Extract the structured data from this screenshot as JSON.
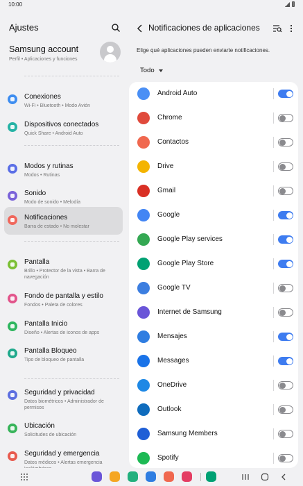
{
  "status": {
    "time": "10:00"
  },
  "left": {
    "title": "Ajustes",
    "account": {
      "name": "Samsung account",
      "sub": "Perfil  •  Aplicaciones y funciones"
    },
    "items": [
      {
        "title": "Conexiones",
        "sub": "Wi-Fi  •  Bluetooth  •  Modo Avión",
        "color": "#3e8df0"
      },
      {
        "title": "Dispositivos conectados",
        "sub": "Quick Share  •  Android Auto",
        "color": "#26b3a5"
      },
      {
        "title": "Modos y rutinas",
        "sub": "Modos  •  Rutinas",
        "color": "#5a6ee6"
      },
      {
        "title": "Sonido",
        "sub": "Modo de sonido  •  Melodía",
        "color": "#7a62d9"
      },
      {
        "title": "Notificaciones",
        "sub": "Barra de estado  •  No molestar",
        "color": "#f0675c"
      },
      {
        "title": "Pantalla",
        "sub": "Brillo  •  Protector de la vista  •  Barra de navegación",
        "color": "#7cc035"
      },
      {
        "title": "Fondo de pantalla y estilo",
        "sub": "Fondos  •  Paleta de colores",
        "color": "#e2558b"
      },
      {
        "title": "Pantalla Inicio",
        "sub": "Diseño  •  Alertas de iconos de apps",
        "color": "#2fb65f"
      },
      {
        "title": "Pantalla Bloqueo",
        "sub": "Tipo de bloqueo de pantalla",
        "color": "#20a98c"
      },
      {
        "title": "Seguridad y privacidad",
        "sub": "Datos biométricos  •  Administrador de permisos",
        "color": "#5d6fe0"
      },
      {
        "title": "Ubicación",
        "sub": "Solicitudes de ubicación",
        "color": "#38b45a"
      },
      {
        "title": "Seguridad y emergencia",
        "sub": "Datos médicos  •  Alertas emergencia inalámbricas",
        "color": "#e85b4f"
      }
    ]
  },
  "right": {
    "title": "Notificaciones de aplicaciones",
    "description": "Elige qué aplicaciones pueden enviarte notificaciones.",
    "filter": "Todo",
    "apps": [
      {
        "name": "Android Auto",
        "enabled": true,
        "icon": "android-auto-icon",
        "color": "#4a8ff5"
      },
      {
        "name": "Chrome",
        "enabled": false,
        "icon": "chrome-icon",
        "color": "#e04a3c"
      },
      {
        "name": "Contactos",
        "enabled": false,
        "icon": "contacts-icon",
        "color": "#f0684f"
      },
      {
        "name": "Drive",
        "enabled": false,
        "icon": "drive-icon",
        "color": "#f4b400"
      },
      {
        "name": "Gmail",
        "enabled": false,
        "icon": "gmail-icon",
        "color": "#d93025"
      },
      {
        "name": "Google",
        "enabled": true,
        "icon": "google-icon",
        "color": "#4285f4"
      },
      {
        "name": "Google Play services",
        "enabled": true,
        "icon": "play-services-icon",
        "color": "#34a853"
      },
      {
        "name": "Google Play Store",
        "enabled": true,
        "icon": "play-store-icon",
        "color": "#00a173"
      },
      {
        "name": "Google TV",
        "enabled": false,
        "icon": "google-tv-icon",
        "color": "#3c7ee0"
      },
      {
        "name": "Internet de Samsung",
        "enabled": false,
        "icon": "samsung-internet-icon",
        "color": "#6a55d8"
      },
      {
        "name": "Mensajes",
        "enabled": true,
        "icon": "messages-icon",
        "color": "#2f7de1"
      },
      {
        "name": "Messages",
        "enabled": true,
        "icon": "google-messages-icon",
        "color": "#1a73e8"
      },
      {
        "name": "OneDrive",
        "enabled": false,
        "icon": "onedrive-icon",
        "color": "#1e88e5"
      },
      {
        "name": "Outlook",
        "enabled": false,
        "icon": "outlook-icon",
        "color": "#0f6cbd"
      },
      {
        "name": "Samsung Members",
        "enabled": false,
        "icon": "samsung-members-icon",
        "color": "#1f5fd6"
      },
      {
        "name": "Spotify",
        "enabled": false,
        "icon": "spotify-icon",
        "color": "#1db954"
      }
    ]
  },
  "dock": [
    {
      "name": "internet-dock-icon",
      "color": "#6a55d8"
    },
    {
      "name": "files-dock-icon",
      "color": "#f5a623"
    },
    {
      "name": "phone-dock-icon",
      "color": "#22b07d"
    },
    {
      "name": "messages-dock-icon",
      "color": "#2f7de1"
    },
    {
      "name": "contacts-dock-icon",
      "color": "#f0684f"
    },
    {
      "name": "screen-recorder-dock-icon",
      "color": "#e43d63"
    },
    {
      "name": "play-store-dock-icon",
      "color": "#00a173"
    }
  ]
}
